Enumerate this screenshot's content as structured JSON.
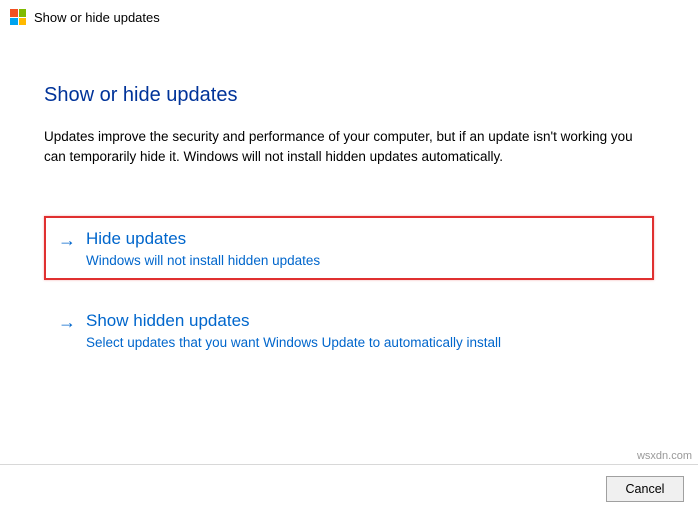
{
  "titlebar": {
    "title": "Show or hide updates"
  },
  "main": {
    "heading": "Show or hide updates",
    "description": "Updates improve the security and performance of your computer, but if an update isn't working you can temporarily hide it. Windows will not install hidden updates automatically."
  },
  "options": [
    {
      "title": "Hide updates",
      "subtitle": "Windows will not install hidden updates",
      "highlighted": true
    },
    {
      "title": "Show hidden updates",
      "subtitle": "Select updates that you want Windows Update to automatically install",
      "highlighted": false
    }
  ],
  "footer": {
    "cancel_label": "Cancel"
  },
  "watermark": "wsxdn.com"
}
